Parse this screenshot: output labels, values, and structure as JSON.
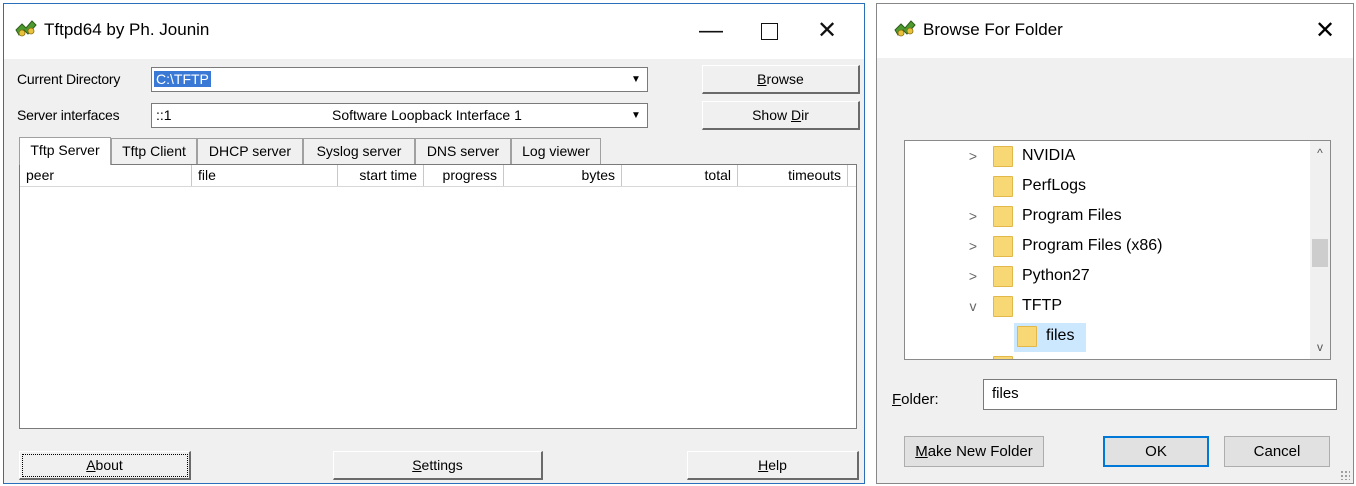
{
  "tftp": {
    "title": "Tftpd64 by Ph. Jounin",
    "controls": {
      "minimize": "—",
      "close": "✕"
    },
    "current_directory": {
      "label": "Current Directory",
      "value": "C:\\TFTP"
    },
    "server_interfaces": {
      "label": "Server interfaces",
      "address": "::1",
      "name": "Software Loopback Interface 1"
    },
    "browse_button": {
      "accel": "B",
      "rest": "rowse"
    },
    "show_dir_button": {
      "before": "Show ",
      "accel": "D",
      "rest": "ir"
    },
    "tabs": [
      "Tftp Server",
      "Tftp Client",
      "DHCP server",
      "Syslog server",
      "DNS server",
      "Log viewer"
    ],
    "columns": [
      "peer",
      "file",
      "start time",
      "progress",
      "bytes",
      "total",
      "timeouts"
    ],
    "about_button": {
      "accel": "A",
      "rest": "bout"
    },
    "settings_button": {
      "accel": "S",
      "rest": "ettings"
    },
    "help_button": {
      "accel": "H",
      "rest": "elp"
    }
  },
  "browse": {
    "title": "Browse For Folder",
    "close": "✕",
    "tree": [
      {
        "label": "NVIDIA",
        "expander": ">"
      },
      {
        "label": "PerfLogs",
        "expander": ""
      },
      {
        "label": "Program Files",
        "expander": ">"
      },
      {
        "label": "Program Files (x86)",
        "expander": ">"
      },
      {
        "label": "Python27",
        "expander": ">"
      },
      {
        "label": "TFTP",
        "expander": "v"
      },
      {
        "label": "files",
        "expander": ""
      }
    ],
    "folder_label": {
      "accel": "F",
      "rest": "older:"
    },
    "folder_value": "files",
    "make_new_folder": {
      "accel": "M",
      "rest": "ake New Folder"
    },
    "ok": "OK",
    "cancel": "Cancel"
  },
  "colors": {
    "selection": "#3a78d6",
    "tree_selection": "#cce8ff",
    "folder": "#f8d775",
    "default_button_border": "#0078d7"
  }
}
